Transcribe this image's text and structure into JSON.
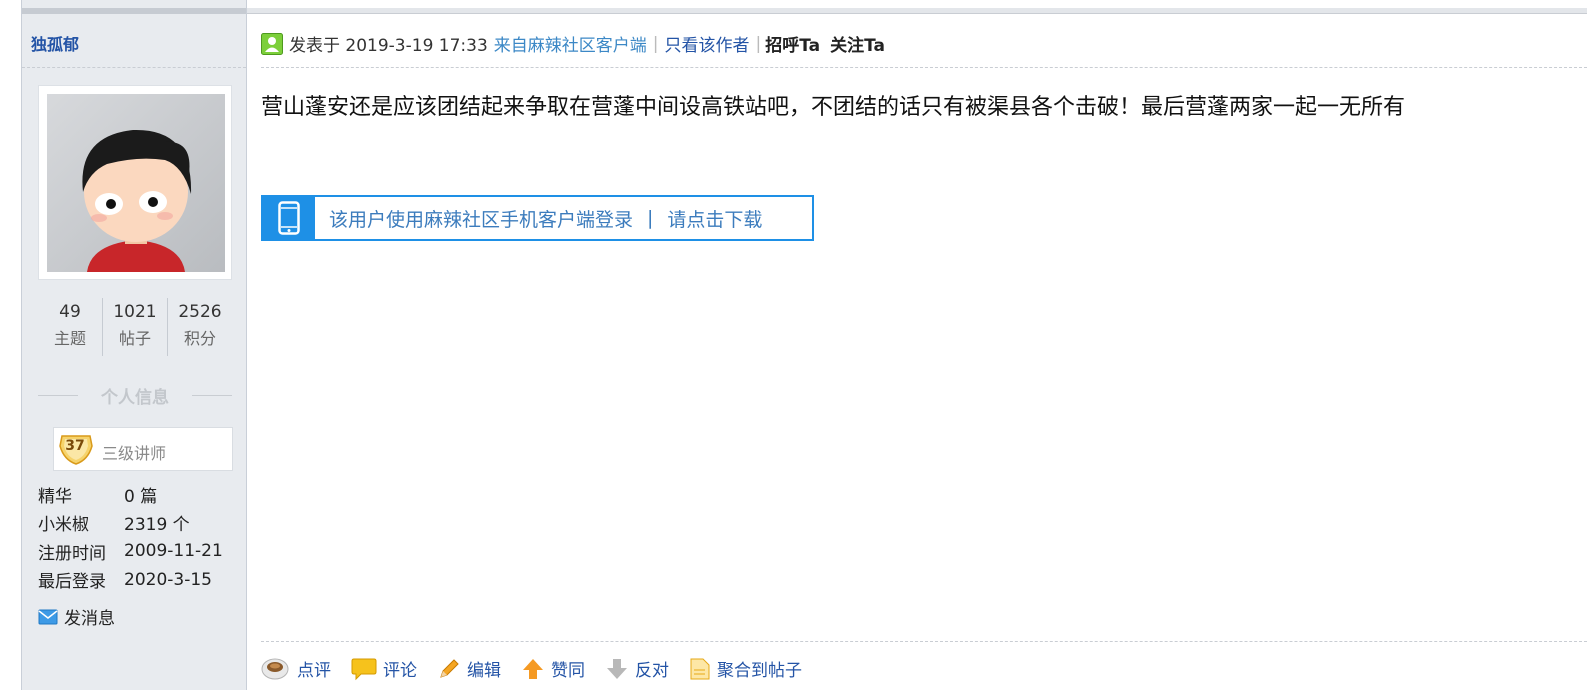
{
  "user": {
    "name": "独孤郁",
    "stats": [
      {
        "value": "49",
        "label": "主题"
      },
      {
        "value": "1021",
        "label": "帖子"
      },
      {
        "value": "2526",
        "label": "积分"
      }
    ],
    "info_title": "个人信息",
    "rank": {
      "level": "37",
      "title": "三级讲师"
    },
    "fields": [
      {
        "key": "精华",
        "value": "0 篇"
      },
      {
        "key": "小米椒",
        "value": "2319 个"
      },
      {
        "key": "注册时间",
        "value": "2009-11-21"
      },
      {
        "key": "最后登录",
        "value": "2020-3-15"
      }
    ],
    "send_message": "发消息"
  },
  "post": {
    "date": "发表于 2019-3-19 17:33",
    "source": "来自麻辣社区客户端",
    "only_author": "只看该作者",
    "greet": "招呼Ta",
    "follow": "关注Ta",
    "body": "营山蓬安还是应该团结起来争取在营蓬中间设高铁站吧，不团结的话只有被渠县各个击破！最后营蓬两家一起一无所有",
    "mobile_banner": {
      "text": "该用户使用麻辣社区手机客户端登录",
      "divider": "|",
      "download": "请点击下载"
    },
    "actions": [
      {
        "icon": "teacup-icon",
        "label": "点评"
      },
      {
        "icon": "speech-bubble-icon",
        "label": "评论"
      },
      {
        "icon": "pencil-icon",
        "label": "编辑"
      },
      {
        "icon": "thumb-up-arrow-icon",
        "label": "赞同"
      },
      {
        "icon": "thumb-down-arrow-icon",
        "label": "反对"
      },
      {
        "icon": "document-icon",
        "label": "聚合到帖子"
      }
    ]
  },
  "colors": {
    "link_blue": "#2454a6",
    "source_blue": "#3c88c6",
    "banner_blue": "#1e90e6",
    "sidebar_bg": "#e8ebef"
  }
}
